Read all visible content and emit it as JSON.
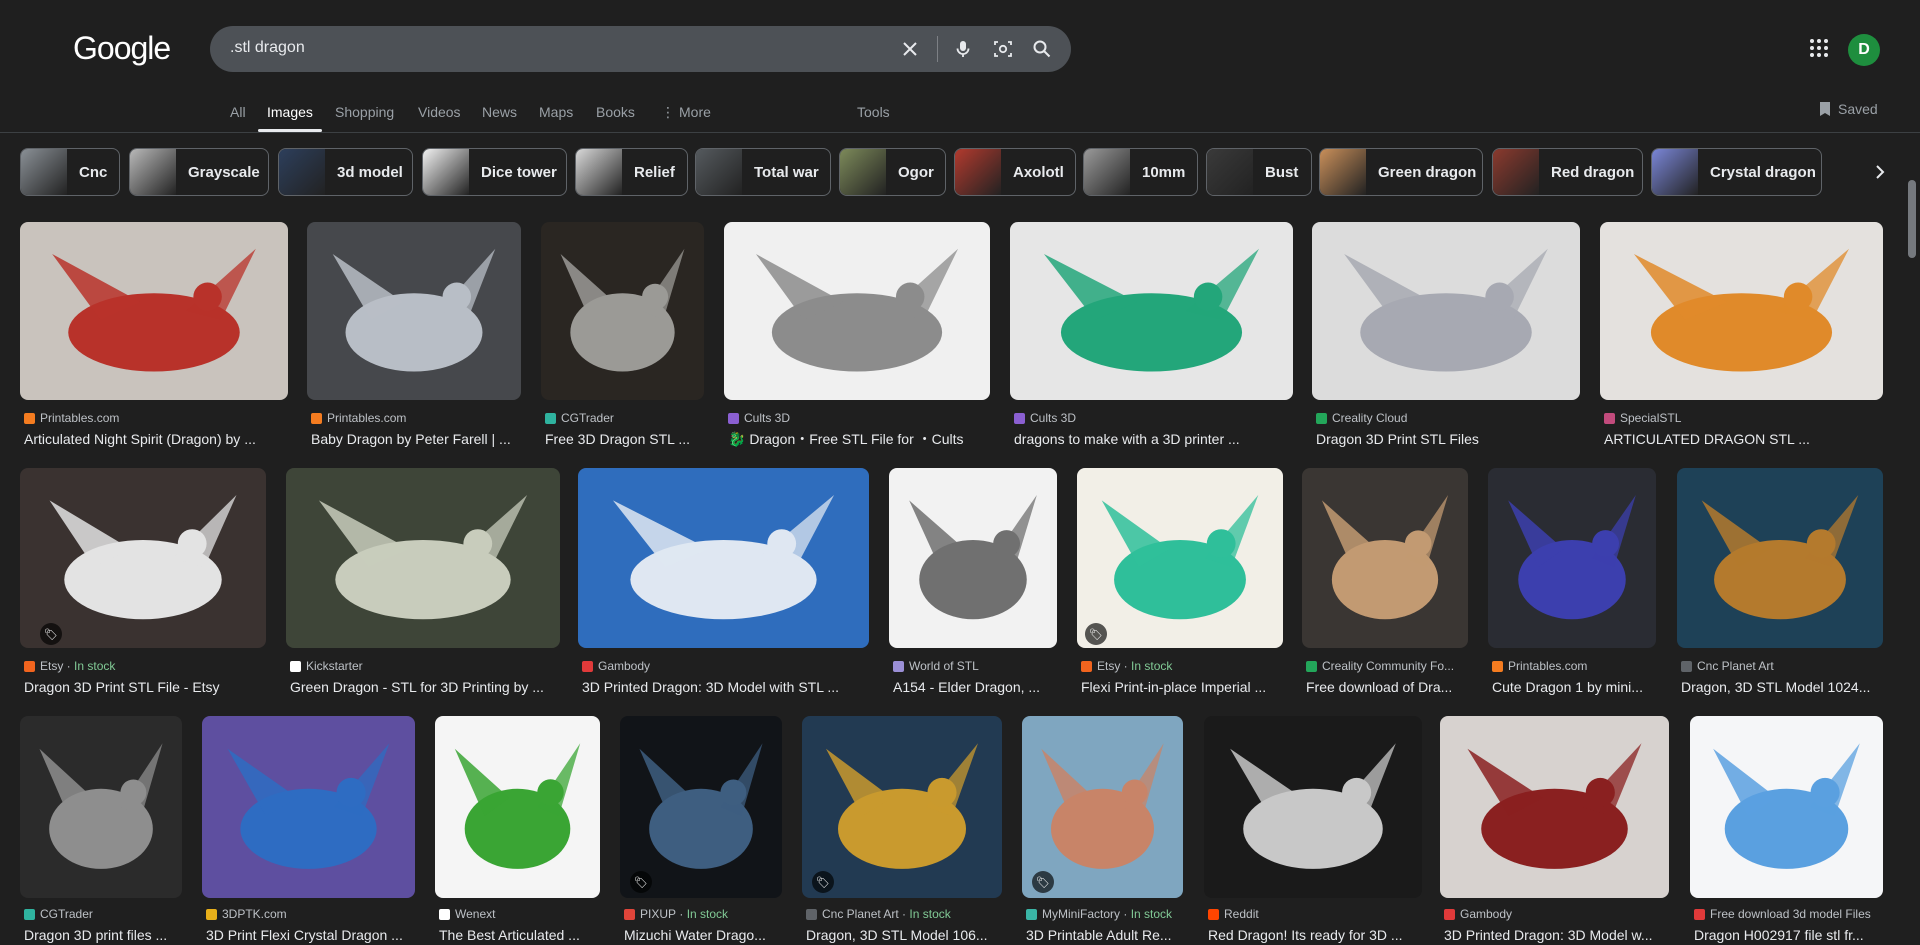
{
  "header": {
    "logo": "Google",
    "search_value": ".stl dragon",
    "avatar_letter": "D"
  },
  "tabs": [
    {
      "label": "All"
    },
    {
      "label": "Images"
    },
    {
      "label": "Shopping"
    },
    {
      "label": "Videos"
    },
    {
      "label": "News"
    },
    {
      "label": "Maps"
    },
    {
      "label": "Books"
    },
    {
      "label": "More"
    }
  ],
  "tools_label": "Tools",
  "saved_label": "Saved",
  "chips": [
    {
      "label": "Cnc",
      "thumb": "#8a9096"
    },
    {
      "label": "Grayscale",
      "thumb": "#b9b9b9"
    },
    {
      "label": "3d model",
      "thumb": "#2d3f5c"
    },
    {
      "label": "Dice tower",
      "thumb": "#f2f2f2"
    },
    {
      "label": "Relief",
      "thumb": "#d9d9d9"
    },
    {
      "label": "Total war",
      "thumb": "#555a5e"
    },
    {
      "label": "Ogor",
      "thumb": "#7d8a5a"
    },
    {
      "label": "Axolotl",
      "thumb": "#b23a2e"
    },
    {
      "label": "10mm",
      "thumb": "#9a9a9a"
    },
    {
      "label": "Bust",
      "thumb": "#3a3a3a"
    },
    {
      "label": "Green dragon",
      "thumb": "#c98f5a"
    },
    {
      "label": "Red dragon",
      "thumb": "#8b3a2e"
    },
    {
      "label": "Crystal dragon",
      "thumb": "#7a86d8"
    }
  ],
  "results": [
    {
      "source": "Printables.com",
      "title": "Articulated Night Spirit (Dragon) by ...",
      "fav": "#f47c20",
      "bg": "#c9c3bd",
      "fg": "#b8322a"
    },
    {
      "source": "Printables.com",
      "title": "Baby Dragon by Peter Farell | ...",
      "fav": "#f47c20",
      "bg": "#46484c",
      "fg": "#b8bec6"
    },
    {
      "source": "CGTrader",
      "title": "Free 3D Dragon STL ...",
      "fav": "#2fb39f",
      "bg": "#2a2622",
      "fg": "#9b9a96"
    },
    {
      "source": "Cults 3D",
      "title": "🐉 Dragon・Free STL File for ・Cults",
      "fav": "#8a5fd1",
      "bg": "#f0f0f0",
      "fg": "#8c8c8c"
    },
    {
      "source": "Cults 3D",
      "title": "dragons to make with a 3D printer ...",
      "fav": "#8a5fd1",
      "bg": "#e6e6e6",
      "fg": "#23a67a"
    },
    {
      "source": "Creality Cloud",
      "title": "Dragon 3D Print STL Files",
      "fav": "#23a65a",
      "bg": "#dcdcdc",
      "fg": "#a7a9b2"
    },
    {
      "source": "SpecialSTL",
      "title": "ARTICULATED DRAGON STL ...",
      "fav": "#c24b7c",
      "bg": "#e4e1de",
      "fg": "#e08a2a"
    },
    {
      "source": "Etsy",
      "stock": "In stock",
      "title": "Dragon 3D Print STL File - Etsy",
      "fav": "#f1641e",
      "bg": "#3a3230",
      "fg": "#e3e3e3"
    },
    {
      "source": "Kickstarter",
      "title": "Green Dragon - STL for 3D Printing by ...",
      "fav": "#ffffff",
      "bg": "#3e4538",
      "fg": "#c8ccbc"
    },
    {
      "source": "Gambody",
      "title": "3D Printed Dragon: 3D Model with STL ...",
      "fav": "#e03a3a",
      "bg": "#2f6dbd",
      "fg": "#dfe7f2"
    },
    {
      "source": "World of STL",
      "title": "A154 - Elder Dragon, ...",
      "fav": "#9b8fd6",
      "bg": "#f2f2f2",
      "fg": "#707070"
    },
    {
      "source": "Etsy",
      "stock": "In stock",
      "title": "Flexi Print-in-place Imperial ...",
      "fav": "#f1641e",
      "bg": "#f2efe7",
      "fg": "#2fbf9a"
    },
    {
      "source": "Creality Community Fo...",
      "title": "Free download of Dra...",
      "fav": "#23a65a",
      "bg": "#3a3633",
      "fg": "#c29a72"
    },
    {
      "source": "Printables.com",
      "title": "Cute Dragon 1 by mini...",
      "fav": "#f47c20",
      "bg": "#2a2c33",
      "fg": "#3c3fae"
    },
    {
      "source": "Cnc Planet Art",
      "title": "Dragon, 3D STL Model 1024...",
      "fav": "#5f6368",
      "bg": "#1e4157",
      "fg": "#b47a2d"
    },
    {
      "source": "CGTrader",
      "title": "Dragon 3D print files ...",
      "fav": "#2fb39f",
      "bg": "#2b2b2b",
      "fg": "#8e8e8e"
    },
    {
      "source": "3DPTK.com",
      "title": "3D Print Flexi Crystal Dragon ...",
      "fav": "#e8b01a",
      "bg": "#5e4fa0",
      "fg": "#2e6cc2"
    },
    {
      "source": "Wenext",
      "title": "The Best Articulated ...",
      "fav": "#ffffff",
      "bg": "#f5f5f5",
      "fg": "#3aa534"
    },
    {
      "source": "PIXUP",
      "stock": "In stock",
      "title": "Mizuchi Water Drago...",
      "fav": "#e0453a",
      "bg": "#111418",
      "fg": "#3e5e80"
    },
    {
      "source": "Cnc Planet Art",
      "stock": "In stock",
      "title": "Dragon, 3D STL Model 106...",
      "fav": "#5f6368",
      "bg": "#223a52",
      "fg": "#c99a2e"
    },
    {
      "source": "MyMiniFactory",
      "stock": "In stock",
      "title": "3D Printable Adult Re...",
      "fav": "#3ab5a6",
      "bg": "#7fa6c0",
      "fg": "#c88468"
    },
    {
      "source": "Reddit",
      "title": "Red Dragon! Its ready for 3D ...",
      "fav": "#ff4500",
      "bg": "#1a1a1a",
      "fg": "#c8c8c8"
    },
    {
      "source": "Gambody",
      "title": "3D Printed Dragon: 3D Model w...",
      "fav": "#e03a3a",
      "bg": "#d7d2cf",
      "fg": "#8a2020"
    },
    {
      "source": "Free download 3d model Files",
      "title": "Dragon H002917 file stl fr...",
      "fav": "#e03a3a",
      "bg": "#f5f6f8",
      "fg": "#5aa0e0"
    }
  ]
}
